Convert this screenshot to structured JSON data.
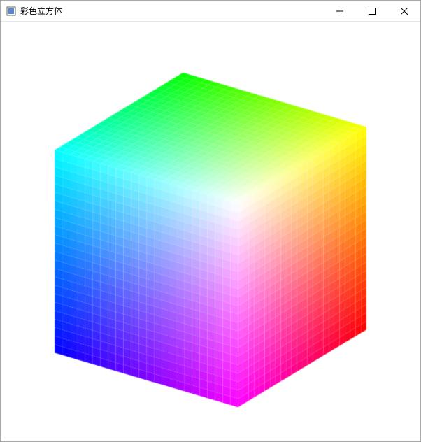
{
  "window": {
    "title": "彩色立方体",
    "icon_name": "app-icon"
  },
  "controls": {
    "minimize_name": "minimize-button",
    "maximize_name": "maximize-button",
    "close_name": "close-button"
  },
  "scene": {
    "object": "rgb-color-cube",
    "background": "#ffffff",
    "rotation_x_deg": 25,
    "rotation_y_deg": -35,
    "vertices_rgb": {
      "black": [
        0,
        0,
        0
      ],
      "red": [
        1,
        0,
        0
      ],
      "green": [
        0,
        1,
        0
      ],
      "blue": [
        0,
        0,
        1
      ],
      "yellow": [
        1,
        1,
        0
      ],
      "cyan": [
        0,
        1,
        1
      ],
      "magenta": [
        1,
        0,
        1
      ],
      "white": [
        1,
        1,
        1
      ]
    }
  }
}
